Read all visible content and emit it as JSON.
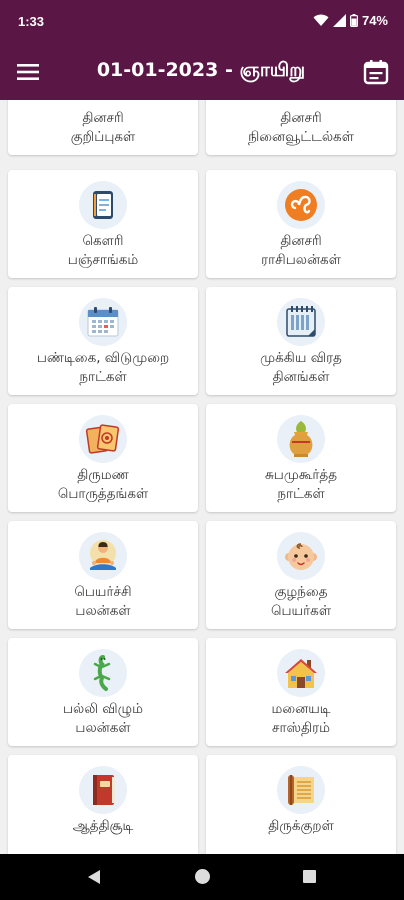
{
  "status_bar": {
    "time": "1:33",
    "battery": "74%"
  },
  "app_bar": {
    "title": "01-01-2023 - ஞாயிறு"
  },
  "colors": {
    "primary": "#5a1645",
    "card": "#ffffff",
    "background": "#f0f0f0"
  },
  "tiles": [
    {
      "line1": "தினசரி",
      "line2": "குறிப்புகள்",
      "icon": "diary-icon"
    },
    {
      "line1": "தினசரி",
      "line2": "நினைவூட்டல்கள்",
      "icon": "reminder-icon"
    },
    {
      "line1": "கௌரி",
      "line2": "பஞ்சாங்கம்",
      "icon": "panchangam-book-icon"
    },
    {
      "line1": "தினசரி",
      "line2": "ராசிபலன்கள்",
      "icon": "leo-zodiac-icon"
    },
    {
      "line1": "பண்டிகை, விடுமுறை",
      "line2": "நாட்கள்",
      "icon": "festival-calendar-icon"
    },
    {
      "line1": "முக்கிய விரத",
      "line2": "தினங்கள்",
      "icon": "fasting-calendar-icon"
    },
    {
      "line1": "திருமண",
      "line2": "பொருத்தங்கள்",
      "icon": "marriage-cards-icon"
    },
    {
      "line1": "சுபமுகூர்த்த",
      "line2": "நாட்கள்",
      "icon": "kalasam-icon"
    },
    {
      "line1": "பெயர்ச்சி",
      "line2": "பலன்கள்",
      "icon": "meditation-icon"
    },
    {
      "line1": "குழந்தை",
      "line2": "பெயர்கள்",
      "icon": "baby-face-icon"
    },
    {
      "line1": "பல்லி விழும்",
      "line2": "பலன்கள்",
      "icon": "lizard-icon"
    },
    {
      "line1": "மனையடி",
      "line2": "சாஸ்திரம்",
      "icon": "house-icon"
    },
    {
      "line1": "ஆத்திசூடி",
      "line2": "",
      "icon": "red-book-icon"
    },
    {
      "line1": "திருக்குறள்",
      "line2": "",
      "icon": "palm-leaf-scroll-icon"
    }
  ]
}
